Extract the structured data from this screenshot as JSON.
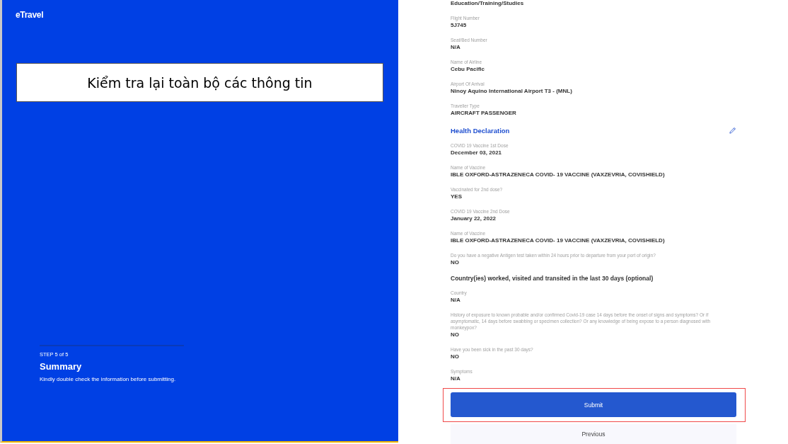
{
  "logo": "eTravel",
  "annotation": "Kiểm tra lại toàn bộ các thông tin",
  "step": {
    "label": "STEP 5 of 5",
    "title": "Summary",
    "description": "Kindly double check the information before submitting."
  },
  "summary": {
    "cut_value": "Education/Training/Studies",
    "items": [
      {
        "kind": "field",
        "label": "Flight Number",
        "value": "5J745"
      },
      {
        "kind": "field",
        "label": "Seat/Bed Number",
        "value": "N/A"
      },
      {
        "kind": "field",
        "label": "Name of Airline",
        "value": "Cebu Pacific"
      },
      {
        "kind": "field",
        "label": "Airport Of Arrival",
        "value": "Ninoy Aquino International Airport T3 - (MNL)"
      },
      {
        "kind": "field",
        "label": "Traveller Type",
        "value": "AIRCRAFT PASSENGER"
      },
      {
        "kind": "section",
        "title": "Health Declaration"
      },
      {
        "kind": "field",
        "label": "COVID 19 Vaccine 1st Dose",
        "value": "December 03, 2021"
      },
      {
        "kind": "field",
        "label": "Name of Vaccine",
        "value": "IBLE OXFORD-ASTRAZENECA COVID- 19 VACCINE (VAXZEVRIA, COVISHIELD)"
      },
      {
        "kind": "field",
        "label": "Vaccinated for 2nd dose?",
        "value": "YES"
      },
      {
        "kind": "field",
        "label": "COVID 19 Vaccine 2nd Dose",
        "value": "January 22, 2022"
      },
      {
        "kind": "field",
        "label": "Name of Vaccine",
        "value": "IBLE OXFORD-ASTRAZENECA COVID- 19 VACCINE (VAXZEVRIA, COVISHIELD)"
      },
      {
        "kind": "field",
        "label": "Do you have a negative Antigen test taken within 24 hours prior to departure from your port of origin?",
        "value": "NO"
      },
      {
        "kind": "subheading",
        "title": "Country(ies) worked, visited and transited in the last 30 days (optional)"
      },
      {
        "kind": "field",
        "label": "Country",
        "value": "N/A"
      },
      {
        "kind": "field",
        "label": "History of exposure to known probable and/or confirmed Covid-19 case 14 days before the onset of signs and symptoms? Or if asymptomatic, 14 days before swabbing or specimen collection? Or any knowledge of being expose to a person diagnosed with monkeypox?",
        "value": "NO"
      },
      {
        "kind": "field",
        "label": "Have you been sick in the past 30 days?",
        "value": "NO"
      },
      {
        "kind": "field",
        "label": "Symptoms",
        "value": "N/A"
      }
    ],
    "buttons": {
      "submit": "Submit",
      "previous": "Previous"
    }
  }
}
